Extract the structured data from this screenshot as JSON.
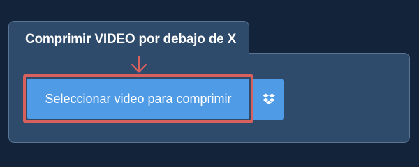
{
  "card": {
    "title": "Comprimir VIDEO por debajo de X"
  },
  "upload": {
    "select_label": "Seleccionar video para comprimir",
    "alt_icon": "dropbox-icon"
  },
  "colors": {
    "page_background": "#13243a",
    "card_background": "#2e4b6c",
    "button": "#4f9be6",
    "highlight": "#d9605d"
  }
}
